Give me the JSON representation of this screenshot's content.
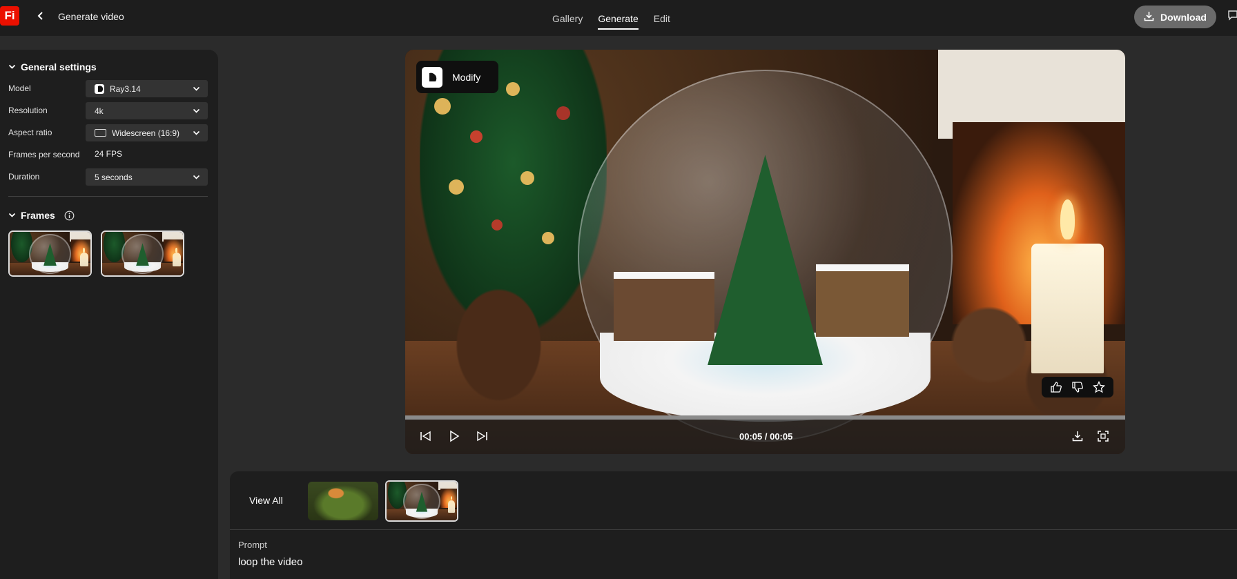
{
  "header": {
    "logo_text": "Fi",
    "back_icon": "chevron-left-icon",
    "title": "Generate video",
    "tabs": [
      {
        "label": "Gallery",
        "active": false
      },
      {
        "label": "Generate",
        "active": true
      },
      {
        "label": "Edit",
        "active": false
      }
    ],
    "download_label": "Download",
    "download_icon": "download-icon",
    "feedback_icon": "comment-icon"
  },
  "sidebar": {
    "general_settings_title": "General settings",
    "model": {
      "label": "Model",
      "value": "Ray3.14"
    },
    "resolution": {
      "label": "Resolution",
      "value": "4k"
    },
    "aspect_ratio": {
      "label": "Aspect ratio",
      "value": "Widescreen (16:9)"
    },
    "fps": {
      "label": "Frames per second",
      "value": "24 FPS"
    },
    "duration": {
      "label": "Duration",
      "value": "5 seconds"
    },
    "frames_title": "Frames",
    "frames_info_icon": "info-icon"
  },
  "player": {
    "modify_label": "Modify",
    "timecode": "00:05 / 00:05",
    "progress": 1.0,
    "icons": {
      "thumbs_up": "thumbs-up-icon",
      "thumbs_down": "thumbs-down-icon",
      "favorite": "star-icon",
      "skip_back": "skip-back-icon",
      "play": "play-icon",
      "skip_forward": "skip-forward-icon",
      "download": "download-icon",
      "fullscreen": "fullscreen-icon"
    }
  },
  "gallery": {
    "view_all_label": "View All"
  },
  "prompt": {
    "label": "Prompt",
    "text": "loop the video"
  },
  "colors": {
    "brand": "#eb1000",
    "background": "#2b2b2b",
    "panel": "#1e1e1e",
    "topbar": "#1d1d1d"
  }
}
